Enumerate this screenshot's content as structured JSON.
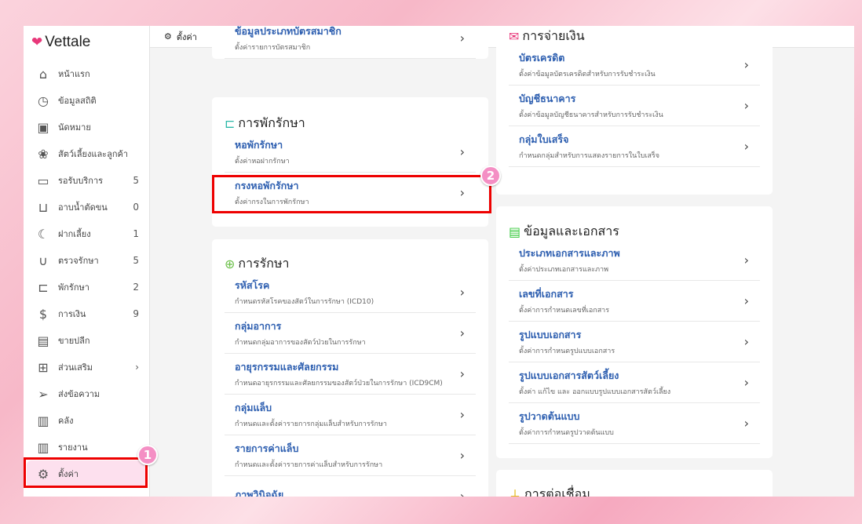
{
  "app": {
    "logo": "Vettale",
    "page_title": "ตั้งค่า"
  },
  "sidebar": {
    "items": [
      {
        "label": "หน้าแรก",
        "icon": "home-icon",
        "count": ""
      },
      {
        "label": "ข้อมูลสถิติ",
        "icon": "gauge-icon",
        "count": ""
      },
      {
        "label": "นัดหมาย",
        "icon": "calendar-icon",
        "count": ""
      },
      {
        "label": "สัตว์เลี้ยงและลูกค้า",
        "icon": "paw-icon",
        "count": ""
      },
      {
        "label": "รอรับบริการ",
        "icon": "sofa-icon",
        "count": "5"
      },
      {
        "label": "อาบน้ำตัดขน",
        "icon": "bathtub-icon",
        "count": "0"
      },
      {
        "label": "ฝากเลี้ยง",
        "icon": "moon-icon",
        "count": "1"
      },
      {
        "label": "ตรวจรักษา",
        "icon": "stethoscope-icon",
        "count": "5"
      },
      {
        "label": "พักรักษา",
        "icon": "bed-icon",
        "count": "2"
      },
      {
        "label": "การเงิน",
        "icon": "money-hand-icon",
        "count": "9"
      },
      {
        "label": "ขายปลีก",
        "icon": "cash-register-icon",
        "count": ""
      },
      {
        "label": "ส่วนเสริม",
        "icon": "plus-square-icon",
        "count": "›"
      },
      {
        "label": "ส่งข้อความ",
        "icon": "send-icon",
        "count": ""
      },
      {
        "label": "คลัง",
        "icon": "archive-icon",
        "count": ""
      },
      {
        "label": "รายงาน",
        "icon": "chart-icon",
        "count": ""
      },
      {
        "label": "ตั้งค่า",
        "icon": "gear-icon",
        "count": ""
      }
    ]
  },
  "left": {
    "member": {
      "items": [
        {
          "title": "ข้อมูลประเภทบัตรสมาชิก",
          "desc": "ตั้งค่ารายการบัตรสมาชิก"
        }
      ]
    },
    "boarding": {
      "title": "การพักรักษา",
      "items": [
        {
          "title": "หอพักรักษา",
          "desc": "ตั้งค่าหอฝากรักษา"
        },
        {
          "title": "กรงหอพักรักษา",
          "desc": "ตั้งค่ากรงในการพักรักษา"
        }
      ]
    },
    "treatment": {
      "title": "การรักษา",
      "items": [
        {
          "title": "รหัสโรค",
          "desc": "กำหนดรหัสโรคของสัตว์ในการรักษา (ICD10)"
        },
        {
          "title": "กลุ่มอาการ",
          "desc": "กำหนดกลุ่มอาการของสัตว์ป่วยในการรักษา"
        },
        {
          "title": "อายุรกรรมและศัลยกรรม",
          "desc": "กำหนดอายุรกรรมและศัลยกรรมของสัตว์ป่วยในการรักษา (ICD9CM)"
        },
        {
          "title": "กลุ่มแล็บ",
          "desc": "กำหนดและตั้งค่ารายการกลุ่มแล็บสำหรับการรักษา"
        },
        {
          "title": "รายการค่าแล็บ",
          "desc": "กำหนดและตั้งค่ารายการค่าแล็บสำหรับการรักษา"
        },
        {
          "title": "ภาพวินิจฉัย",
          "desc": ""
        }
      ]
    }
  },
  "right": {
    "payment": {
      "title": "การจ่ายเงิน",
      "items": [
        {
          "title": "บัตรเครดิต",
          "desc": "ตั้งค่าข้อมูลบัตรเครดิตสำหรับการรับชำระเงิน"
        },
        {
          "title": "บัญชีธนาคาร",
          "desc": "ตั้งค่าข้อมูลบัญชีธนาคารสำหรับการรับชำระเงิน"
        },
        {
          "title": "กลุ่มใบเสร็จ",
          "desc": "กำหนดกลุ่มสำหรับการแสดงรายการในใบเสร็จ"
        }
      ]
    },
    "documents": {
      "title": "ข้อมูลและเอกสาร",
      "items": [
        {
          "title": "ประเภทเอกสารและภาพ",
          "desc": "ตั้งค่าประเภทเอกสารและภาพ"
        },
        {
          "title": "เลขที่เอกสาร",
          "desc": "ตั้งค่าการกำหนดเลขที่เอกสาร"
        },
        {
          "title": "รูปแบบเอกสาร",
          "desc": "ตั้งค่าการกำหนดรูปแบบเอกสาร"
        },
        {
          "title": "รูปแบบเอกสารสัตว์เลี้ยง",
          "desc": "ตั้งค่า แก้ไข และ ออกแบบรูปแบบเอกสารสัตว์เลี้ยง"
        },
        {
          "title": "รูปวาดต้นแบบ",
          "desc": "ตั้งค่าการกำหนดรูปวาดต้นแบบ"
        }
      ]
    },
    "integration": {
      "title": "การต่อเชื่อม"
    }
  },
  "annotations": {
    "step1": "1",
    "step2": "2"
  },
  "colors": {
    "accent": "#2e5fb0",
    "highlight": "#ee0000",
    "badge": "#f48fc4",
    "active_bg": "#fde0ee"
  }
}
